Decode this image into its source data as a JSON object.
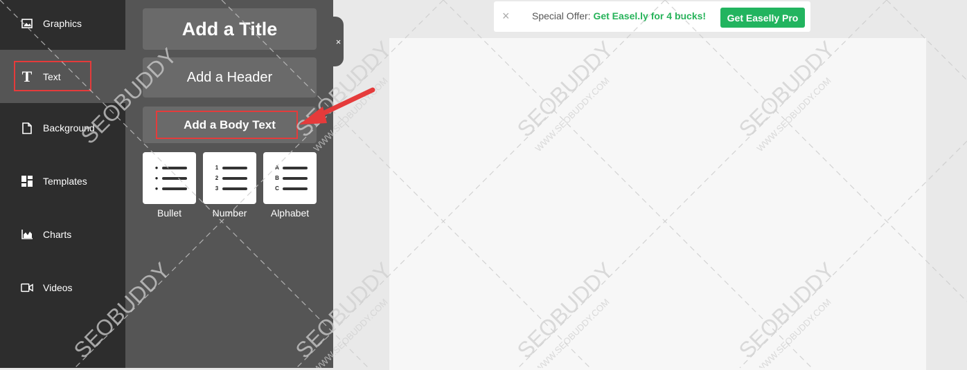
{
  "nav": {
    "items": [
      {
        "label": "Graphics",
        "icon": "image-icon"
      },
      {
        "label": "Text",
        "icon": "text-t-icon"
      },
      {
        "label": "Background",
        "icon": "file-icon"
      },
      {
        "label": "Templates",
        "icon": "templates-grid-icon"
      },
      {
        "label": "Charts",
        "icon": "bar-chart-icon"
      },
      {
        "label": "Videos",
        "icon": "video-camera-icon"
      }
    ]
  },
  "text_panel": {
    "title_btn": "Add a Title",
    "header_btn": "Add a Header",
    "body_btn": "Add a Body Text",
    "lists": [
      {
        "label": "Bullet",
        "markers": [
          "",
          "",
          ""
        ]
      },
      {
        "label": "Number",
        "markers": [
          "1",
          "2",
          "3"
        ]
      },
      {
        "label": "Alphabet",
        "markers": [
          "A",
          "B",
          "C"
        ]
      }
    ],
    "collapse": "×"
  },
  "offer": {
    "close": "×",
    "text": "Special Offer: ",
    "link": "Get Easel.ly for 4 bucks!",
    "button": "Get Easelly Pro"
  },
  "watermark": {
    "brand": "SEOBUDDY",
    "url": "WWW.SEOBUDDY.COM"
  },
  "colors": {
    "accent_green": "#22b45f",
    "highlight_red": "#e53b3b",
    "nav_bg": "#2d2d2d",
    "panel_bg": "#555555"
  }
}
